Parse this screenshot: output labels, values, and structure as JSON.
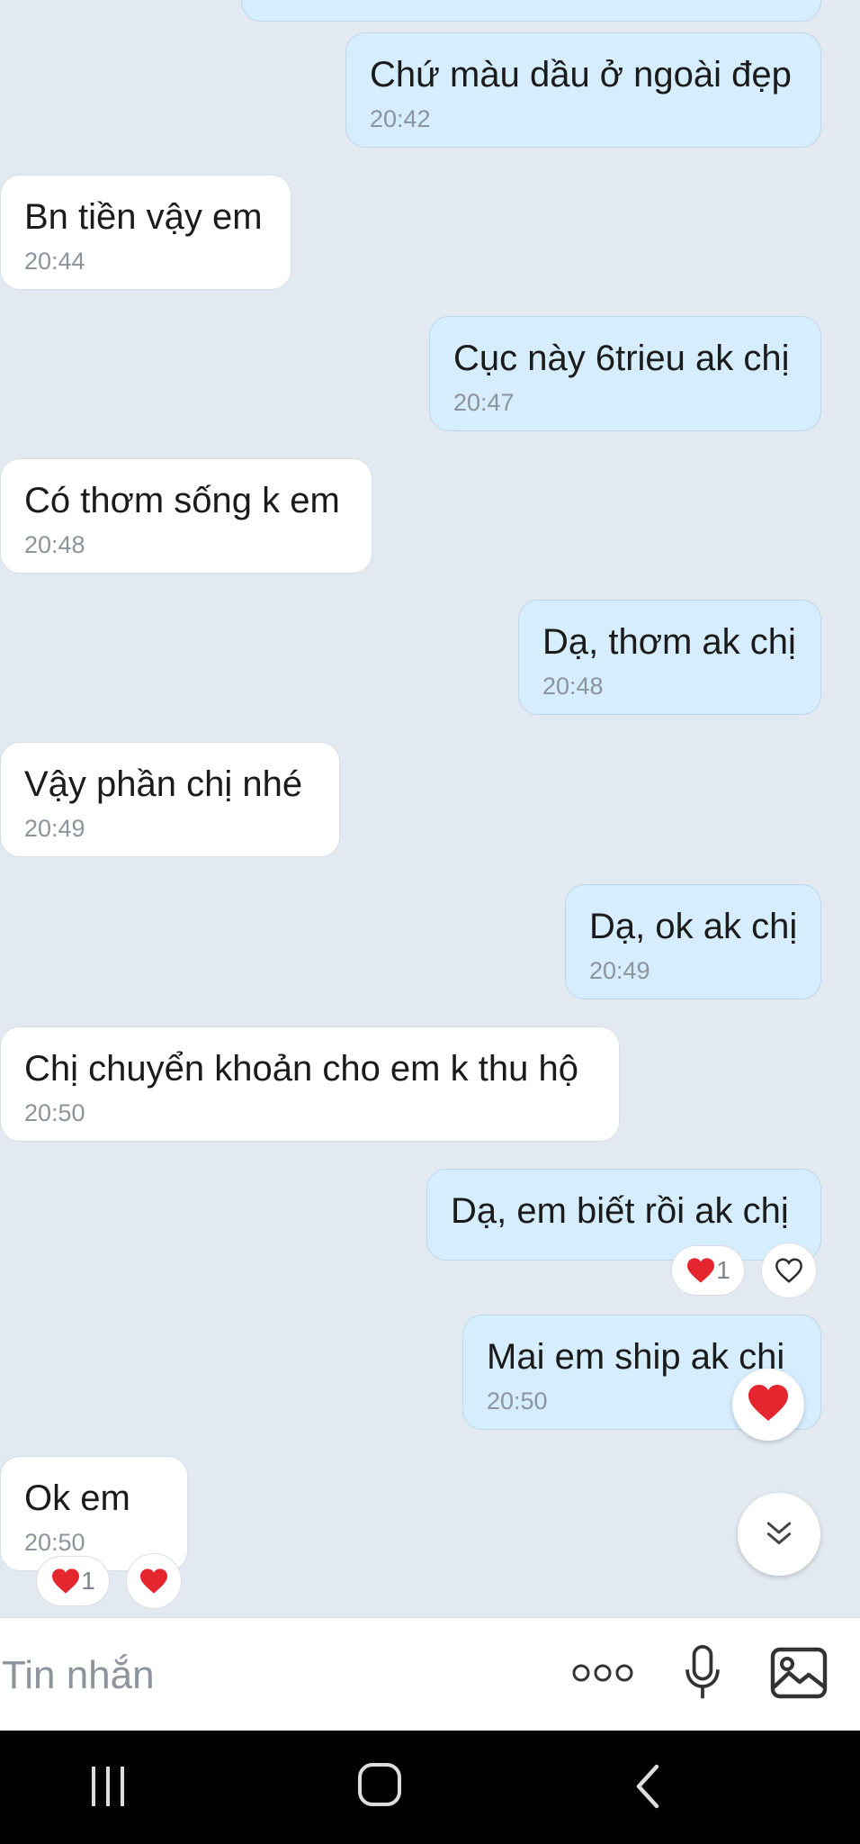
{
  "messages": [
    {
      "text": "Chứ màu dầu ở ngoài đẹp",
      "time": "20:42"
    },
    {
      "text": "Bn tiền vậy em",
      "time": "20:44"
    },
    {
      "text": "Cục này 6trieu ak chị",
      "time": "20:47"
    },
    {
      "text": "Có thơm sống k em",
      "time": "20:48"
    },
    {
      "text": "Dạ, thơm ak chị",
      "time": "20:48"
    },
    {
      "text": "Vậy phần chị nhé",
      "time": "20:49"
    },
    {
      "text": "Dạ, ok ak chị",
      "time": "20:49"
    },
    {
      "text": "Chị chuyển khoản cho em k thu hộ",
      "time": "20:50"
    },
    {
      "text": "Dạ, em biết rồi ak chị",
      "time": ""
    },
    {
      "text": "Mai em ship ak chị",
      "time": "20:50"
    },
    {
      "text": "Ok em",
      "time": "20:50"
    }
  ],
  "reactions": {
    "msg9_count": "1",
    "msg11_count": "1"
  },
  "composer": {
    "placeholder": "Tin nhắn"
  },
  "icons": {
    "heart": "heart-icon",
    "heart_outline": "heart-outline-icon",
    "scroll_down": "double-chevron-down-icon",
    "more": "more-icon",
    "mic": "microphone-icon",
    "image": "image-icon",
    "recents": "recent-apps-icon",
    "home": "home-icon",
    "back": "back-icon"
  },
  "colors": {
    "background": "#e2e9f1",
    "incoming_bubble": "#ffffff",
    "outgoing_bubble": "#d5edfc",
    "heart": "#e5262e"
  }
}
